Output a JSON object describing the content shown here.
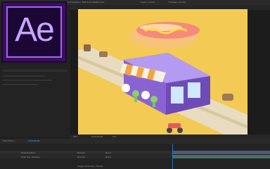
{
  "app": {
    "logo_text": "Ae",
    "logo_color": "#9f66ff",
    "logo_bg": "#1c0633"
  },
  "tabs": [
    "Composition: Fast Food Restaurant",
    "Layer: (none)",
    "Footage: (none)"
  ],
  "timeline": {
    "comp_tab": "Fast Food 1",
    "timecode": "0;00;00;00",
    "layers": [
      {
        "name": "Shell Rotation",
        "mode": "Normal",
        "parent": "None"
      },
      {
        "name": "Shell Top_Shadow",
        "mode": "Normal",
        "parent": "None"
      }
    ],
    "footer": "Toggle Switches / Modes"
  },
  "viewer": {
    "zoom": "50%",
    "resolution": "Full",
    "time": "0;00;00;00"
  },
  "colors": {
    "comp_bg": "#f3ca54",
    "accent_blue": "#2d6ebd",
    "ui_dark": "#1f1f1f"
  }
}
